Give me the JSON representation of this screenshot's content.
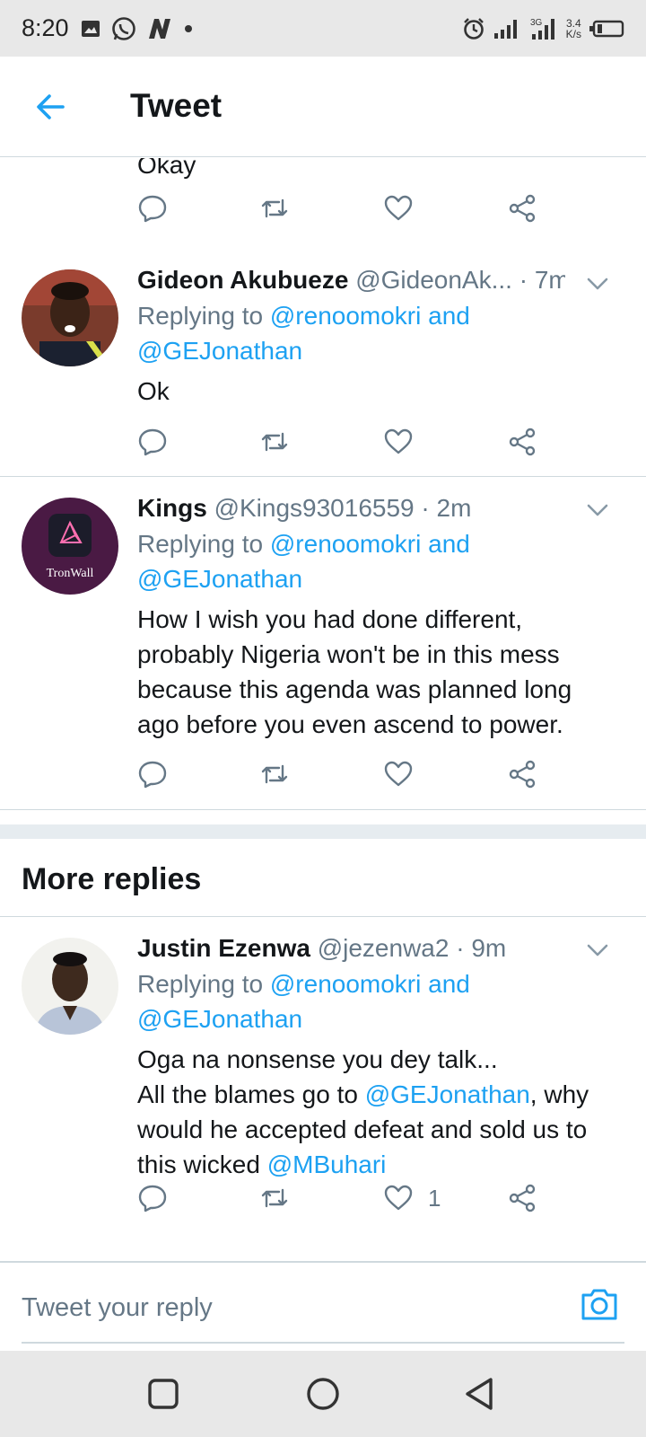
{
  "status_bar": {
    "time": "8:20",
    "network_speed_value": "3.4",
    "network_speed_unit": "K/s",
    "network_type": "3G",
    "icons": [
      "image-icon",
      "whatsapp-icon",
      "n-app-icon",
      "dot-icon",
      "alarm-icon",
      "signal-icon",
      "signal-3g-icon",
      "battery-icon"
    ]
  },
  "header": {
    "title": "Tweet",
    "back_icon": "arrow-left-icon"
  },
  "partial_tweet": {
    "text": "Okay"
  },
  "tweets": [
    {
      "name": "Gideon Akubueze",
      "handle": "@GideonAk...",
      "time": " · 7m",
      "replying_prefix": "Replying to ",
      "replying_to_1": "@renoomokri",
      "replying_and": " and",
      "replying_to_2": "@GEJonathan",
      "text": "Ok",
      "avatar_desc": "avatar-photo"
    },
    {
      "name": "Kings",
      "handle": "@Kings93016559",
      "time": " · 2m",
      "replying_prefix": "Replying to ",
      "replying_to_1": "@renoomokri",
      "replying_and": " and",
      "replying_to_2": "@GEJonathan",
      "text": "How I wish you had done different, probably Nigeria won't be in this mess because this agenda was planned long ago before you even ascend to power.",
      "avatar_label": "TronWall"
    }
  ],
  "more_replies": {
    "title": "More replies",
    "tweet": {
      "name": "Justin Ezenwa",
      "handle": "@jezenwa2",
      "time": " · 9m",
      "replying_prefix": "Replying to ",
      "replying_to_1": "@renoomokri",
      "replying_and": " and",
      "replying_to_2": "@GEJonathan",
      "text_line1": "Oga na nonsense you dey talk...",
      "text_line2_prefix": "All the blames go to ",
      "text_line2_mention": "@GEJonathan",
      "text_line2_suffix": ", why would he accepted defeat and sold us to this wicked ",
      "text_mention_2": "@MBuhari",
      "like_count": "1"
    }
  },
  "reply_bar": {
    "placeholder": "Tweet your reply",
    "camera_icon": "camera-icon"
  },
  "nav_bar": {
    "icons": [
      "recents-square-icon",
      "home-circle-icon",
      "back-triangle-icon"
    ]
  },
  "colors": {
    "accent": "#1da1f2",
    "text": "#14171a",
    "secondary_text": "#657786",
    "divider": "#cfd9de"
  }
}
